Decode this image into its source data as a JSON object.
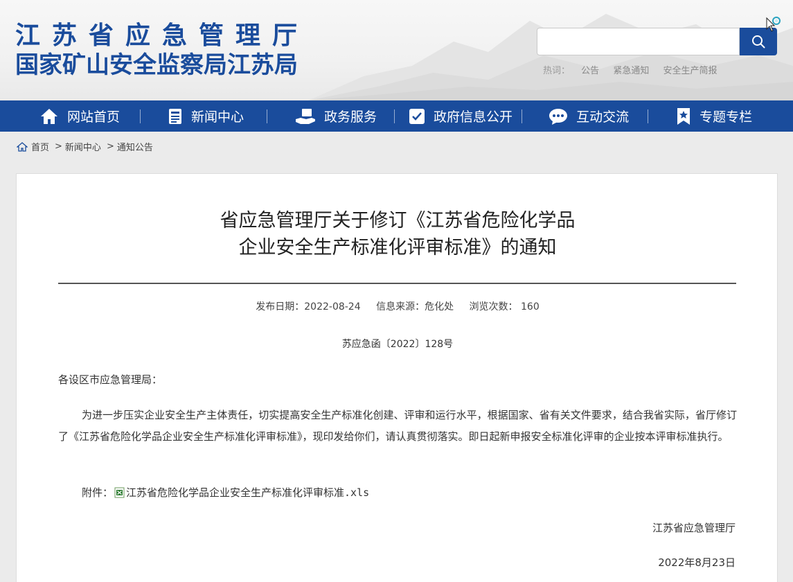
{
  "header": {
    "logo_line1": "江苏省应急管理厅",
    "logo_line2": "国家矿山安全监察局江苏局",
    "search_value": "",
    "hot_label": "热词：",
    "hot_words": [
      "公告",
      "紧急通知",
      "安全生产简报"
    ]
  },
  "nav": {
    "items": [
      {
        "label": "网站首页",
        "icon": "home-icon"
      },
      {
        "label": "新闻中心",
        "icon": "news-icon"
      },
      {
        "label": "政务服务",
        "icon": "service-icon"
      },
      {
        "label": "政府信息公开",
        "icon": "info-icon"
      },
      {
        "label": "互动交流",
        "icon": "chat-icon"
      },
      {
        "label": "专题专栏",
        "icon": "bookmark-icon"
      }
    ]
  },
  "breadcrumb": {
    "home": "首页",
    "level1": "新闻中心",
    "level2": "通知公告",
    "separator": ">"
  },
  "article": {
    "title_line1": "省应急管理厅关于修订《江苏省危险化学品",
    "title_line2": "企业安全生产标准化评审标准》的通知",
    "publish_date": "发布日期：2022-08-24",
    "source": "信息来源：危化处",
    "views_label": "浏览次数：",
    "views": "160",
    "doc_number": "苏应急函〔2022〕128号",
    "salutation": "各设区市应急管理局：",
    "paragraph": "为进一步压实企业安全生产主体责任，切实提高安全生产标准化创建、评审和运行水平，根据国家、省有关文件要求，结合我省实际，省厅修订了《江苏省危险化学品企业安全生产标准化评审标准》，现印发给你们，请认真贯彻落实。即日起新申报安全标准化评审的企业按本评审标准执行。",
    "attachment_label": "附件：",
    "attachment_name": "江苏省危险化学品企业安全生产标准化评审标准",
    "attachment_ext": ".xls",
    "signature": "江苏省应急管理厅",
    "date": "2022年8月23日"
  },
  "colors": {
    "brand": "#1a4c9c",
    "page_bg": "#ebebeb"
  }
}
